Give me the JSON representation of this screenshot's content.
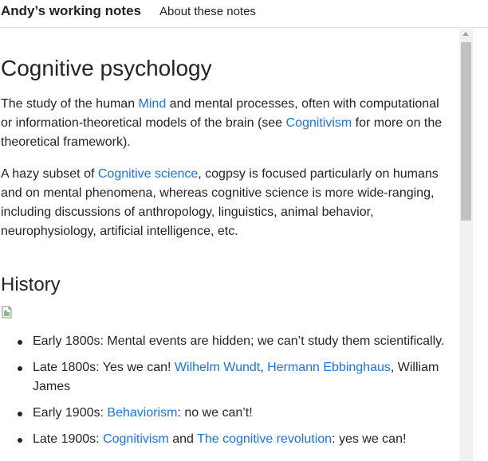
{
  "header": {
    "brand": "Andy’s working notes",
    "nav_link": "About these notes"
  },
  "page": {
    "title": "Cognitive psychology",
    "p1": {
      "t1": "The study of the human ",
      "link1": "Mind",
      "t2": " and mental processes, often with computational or information-theoretical models of the brain (see ",
      "link2": "Cognitivism",
      "t3": " for more on the theoretical framework)."
    },
    "p2": {
      "t1": "A hazy subset of ",
      "link1": "Cognitive science",
      "t2": ", cogpsy is focused particularly on humans and on mental phenomena, whereas cognitive science is more wide-ranging, including discussions of anthropology, linguistics, animal behavior, neurophysiology, artificial intelligence, etc."
    },
    "history_heading": "History",
    "history_items": [
      {
        "text": "Early 1800s: Mental events are hidden; we can’t study them scientifically."
      },
      {
        "t1": "Late 1800s: Yes we can! ",
        "link1": "Wilhelm Wundt",
        "sep": ", ",
        "link2": "Hermann Ebbinghaus",
        "t2": ", William James"
      },
      {
        "t1": "Early 1900s: ",
        "link1": "Behaviorism",
        "t2": ": no we can’t!"
      },
      {
        "t1": "Late 1900s: ",
        "link1": "Cognitivism",
        "t2": " and ",
        "link2": "The cognitive revolution",
        "t3": ": yes we can!"
      }
    ]
  },
  "colors": {
    "link": "#1a73e8",
    "text": "#212529"
  }
}
